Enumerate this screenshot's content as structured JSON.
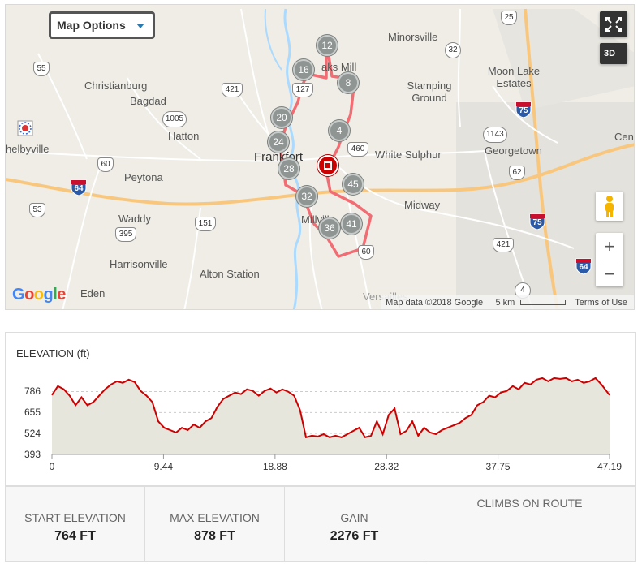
{
  "map": {
    "options_label": "Map Options",
    "threed_label": "3D",
    "places": {
      "minorsville": "Minorsville",
      "christianburg": "Christianburg",
      "bagdad": "Bagdad",
      "oaks_mill": "aks Mill",
      "stamping_ground": "Stamping Ground",
      "moon_lake": "Moon Lake Estates",
      "hatton": "Hatton",
      "shelbyville": "helbyville",
      "frankfort": "Frankfort",
      "white_sulphur": "White Sulphur",
      "georgetown": "Georgetown",
      "centerville": "Cent",
      "peytona": "Peytona",
      "midway": "Midway",
      "waddy": "Waddy",
      "millville": "Millville",
      "harrisonville": "Harrisonville",
      "alton_station": "Alton Station",
      "eden": "Eden",
      "versailles": "Versailles"
    },
    "shields": {
      "r25": "25",
      "r32": "32",
      "r55": "55",
      "r421a": "421",
      "r127": "127",
      "r1005": "1005",
      "r460": "460",
      "r1143": "1143",
      "r60a": "60",
      "r62": "62",
      "r53": "53",
      "r395": "395",
      "r151": "151",
      "r421b": "421",
      "r60b": "60",
      "r4": "4"
    },
    "interstates": {
      "i64a": "64",
      "i75a": "75",
      "i75b": "75",
      "i64b": "64"
    },
    "markers": [
      "12",
      "16",
      "8",
      "20",
      "4",
      "24",
      "28",
      "45",
      "32",
      "41",
      "36"
    ],
    "google_logo": "Google",
    "attribution": {
      "map_data": "Map data ©2018 Google",
      "scale": "5 km",
      "terms": "Terms of Use"
    },
    "colors": {
      "route": "#f26d73",
      "land": "#efede6",
      "river": "#aadaff",
      "highway": "#f8c77d"
    }
  },
  "elevation": {
    "title": "ELEVATION (ft)",
    "y_ticks": [
      "786",
      "655",
      "524",
      "393"
    ],
    "x_ticks": [
      "0",
      "9.44",
      "18.88",
      "28.32",
      "37.75",
      "47.19"
    ]
  },
  "chart_data": {
    "type": "area",
    "title": "ELEVATION (ft)",
    "xlabel": "",
    "ylabel": "",
    "xlim": [
      0,
      47.19
    ],
    "ylim": [
      393,
      900
    ],
    "y_ticks": [
      786,
      655,
      524,
      393
    ],
    "x_ticks": [
      0,
      9.44,
      18.88,
      28.32,
      37.75,
      47.19
    ],
    "color": "#cc0000",
    "fill": "#e6e6dc",
    "series": [
      {
        "x": [
          0,
          0.5,
          1.0,
          1.5,
          2.0,
          2.5,
          3.0,
          3.5,
          4.0,
          4.5,
          5.0,
          5.5,
          6.0,
          6.5,
          7.0,
          7.5,
          8.0,
          8.5,
          9.0,
          9.5,
          10.0,
          10.5,
          11.0,
          11.5,
          12.0,
          12.5,
          13.0,
          13.5,
          14.0,
          14.5,
          15.0,
          15.5,
          16.0,
          16.5,
          17.0,
          17.5,
          18.0,
          18.5,
          19.0,
          19.5,
          20.0,
          20.5,
          21.0,
          21.5,
          22.0,
          22.5,
          23.0,
          23.5,
          24.0,
          24.5,
          25.0,
          25.5,
          26.0,
          26.5,
          27.0,
          27.5,
          28.0,
          28.5,
          29.0,
          29.5,
          30.0,
          30.5,
          31.0,
          31.5,
          32.0,
          32.5,
          33.0,
          33.5,
          34.0,
          34.5,
          35.0,
          35.5,
          36.0,
          36.5,
          37.0,
          37.5,
          38.0,
          38.5,
          39.0,
          39.5,
          40.0,
          40.5,
          41.0,
          41.5,
          42.0,
          42.5,
          43.0,
          43.5,
          44.0,
          44.5,
          45.0,
          45.5,
          46.0,
          46.5,
          47.19
        ],
        "y": [
          764,
          820,
          800,
          760,
          700,
          750,
          700,
          720,
          760,
          800,
          830,
          850,
          840,
          860,
          845,
          790,
          760,
          720,
          600,
          560,
          545,
          530,
          560,
          545,
          580,
          560,
          600,
          620,
          690,
          740,
          760,
          780,
          770,
          800,
          790,
          760,
          790,
          805,
          780,
          800,
          785,
          760,
          670,
          500,
          510,
          505,
          520,
          500,
          510,
          500,
          520,
          540,
          560,
          500,
          510,
          600,
          520,
          640,
          680,
          520,
          540,
          600,
          510,
          560,
          530,
          520,
          545,
          560,
          575,
          590,
          620,
          640,
          700,
          720,
          760,
          750,
          780,
          790,
          820,
          800,
          840,
          830,
          860,
          870,
          850,
          870,
          865,
          870,
          850,
          860,
          840,
          850,
          870,
          830,
          764
        ]
      }
    ]
  },
  "stats": {
    "start_label": "START ELEVATION",
    "start_value": "764 FT",
    "max_label": "MAX ELEVATION",
    "max_value": "878 FT",
    "gain_label": "GAIN",
    "gain_value": "2276 FT",
    "climbs_label": "CLIMBS ON ROUTE"
  }
}
